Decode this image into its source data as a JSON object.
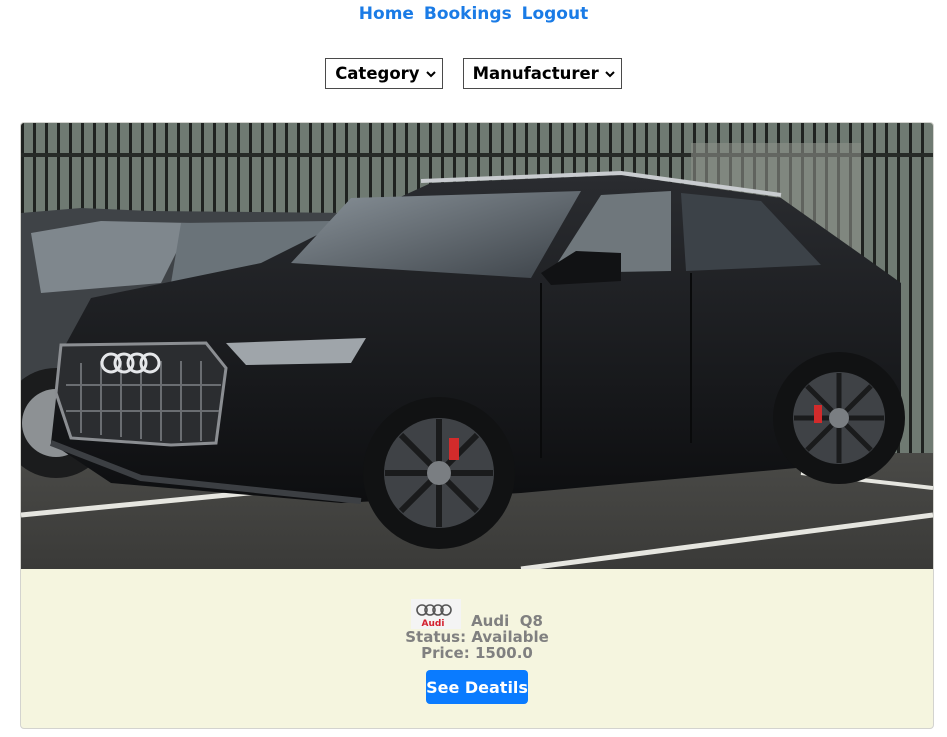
{
  "nav": {
    "home": "Home",
    "bookings": "Bookings",
    "logout": "Logout"
  },
  "filters": {
    "category": "Category",
    "manufacturer": "Manufacturer"
  },
  "car": {
    "brand": "Audi",
    "model": "Q8",
    "status_label": "Status:",
    "status": "Available",
    "price_label": "Price:",
    "price": "1500.0",
    "logo_text": "Audi",
    "button": "See Deatils"
  },
  "colors": {
    "link": "#1a7be6",
    "button": "#0a7bff",
    "card_bg": "#f5f5df",
    "info_text": "#808080",
    "logo_red": "#d3202f"
  },
  "icons": {
    "dropdown": "chevron-down-icon"
  }
}
